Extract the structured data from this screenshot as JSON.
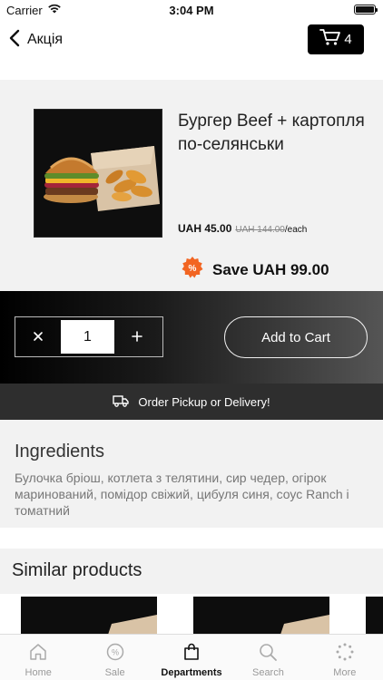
{
  "status_bar": {
    "carrier": "Carrier",
    "time": "3:04 PM"
  },
  "nav": {
    "back_label": "Акція",
    "cart_count": "4"
  },
  "product": {
    "title": "Бургер Beef + картопля по-селянськи",
    "price": "UAH 45.00",
    "old_price": "UAH 144.00",
    "unit": "/each",
    "save_text": "Save UAH 99.00"
  },
  "cart_controls": {
    "quantity": "1",
    "add_label": "Add to Cart"
  },
  "delivery": {
    "label": "Order Pickup or Delivery!"
  },
  "ingredients": {
    "heading": "Ingredients",
    "text": "Булочка бріош, котлета з телятини, сир чедер, огірок маринований, помідор свіжий, цибуля синя, соус Ranch і томатний"
  },
  "similar": {
    "heading": "Similar products"
  },
  "tabs": [
    {
      "label": "Home",
      "icon": "home-icon",
      "active": false
    },
    {
      "label": "Sale",
      "icon": "sale-icon",
      "active": false
    },
    {
      "label": "Departments",
      "icon": "bag-icon",
      "active": true
    },
    {
      "label": "Search",
      "icon": "search-icon",
      "active": false
    },
    {
      "label": "More",
      "icon": "more-icon",
      "active": false
    }
  ],
  "colors": {
    "accent_badge": "#f26522",
    "dark": "#000000",
    "panel_bg": "#f2f2f2"
  }
}
